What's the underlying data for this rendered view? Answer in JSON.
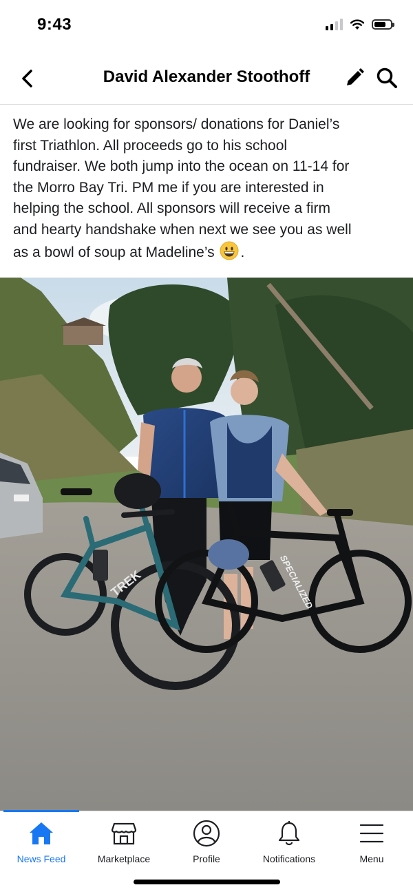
{
  "status_bar": {
    "time": "9:43"
  },
  "nav": {
    "title": "David Alexander Stoothoff",
    "back_icon": "chevron-left-icon",
    "edit_icon": "pencil-icon",
    "search_icon": "search-icon"
  },
  "post": {
    "text_lines": [
      "We are looking for sponsors/ donations for Daniel’s",
      "first Triathlon. All proceeds go to his school",
      "fundraiser.  We both jump into the ocean on 11-14 for",
      "the Morro Bay Tri. PM me if you are interested in",
      "helping the school. All sponsors will receive a firm",
      "and hearty handshake when next we see you as well",
      "as a bowl of soup at Madeline’s"
    ],
    "text_end": ".",
    "emoji": "grinning-face-emoji",
    "photo_bike_brands": [
      "TREK",
      "SPECIALIZED"
    ]
  },
  "tabs": [
    {
      "label": "News Feed",
      "icon": "home-icon",
      "active": true
    },
    {
      "label": "Marketplace",
      "icon": "shop-icon",
      "active": false
    },
    {
      "label": "Profile",
      "icon": "profile-icon",
      "active": false
    },
    {
      "label": "Notifications",
      "icon": "bell-icon",
      "active": false
    },
    {
      "label": "Menu",
      "icon": "menu-icon",
      "active": false
    }
  ],
  "colors": {
    "accent": "#1877f2",
    "text": "#1c1e21"
  }
}
